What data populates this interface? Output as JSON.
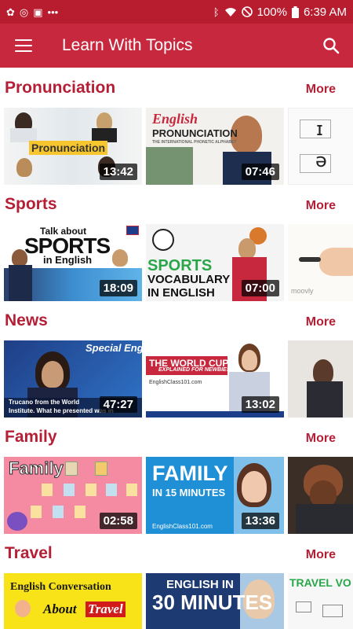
{
  "status": {
    "battery": "100%",
    "time": "6:39 AM"
  },
  "appbar": {
    "title": "Learn With Topics"
  },
  "sections": [
    {
      "title": "Pronunciation",
      "more": "More",
      "videos": [
        {
          "duration": "13:42",
          "caption": "Pronunciation"
        },
        {
          "duration": "07:46",
          "caption_1": "English",
          "caption_2": "PRONUNCIATION",
          "caption_3": "THE INTERNATIONAL PHONETIC ALPHABET"
        },
        {
          "caption_1": "ɪ",
          "caption_2": "ə"
        }
      ]
    },
    {
      "title": "Sports",
      "more": "More",
      "videos": [
        {
          "duration": "18:09",
          "caption_1": "Talk about",
          "caption_2": "SPORTS",
          "caption_3": "in English"
        },
        {
          "duration": "07:00",
          "caption_1": "SPORTS",
          "caption_2": "VOCABULARY",
          "caption_3": "IN ENGLISH"
        },
        {
          "caption_1": "moovly"
        }
      ]
    },
    {
      "title": "News",
      "more": "More",
      "videos": [
        {
          "duration": "47:27",
          "caption_1": "Special English",
          "caption_2": "Trucano from the World",
          "caption_3": "Institute. What he presented was in"
        },
        {
          "duration": "13:02",
          "caption_1": "THE WORLD CUP",
          "caption_2": "EXPLAINED FOR NEWBIES!",
          "caption_3": "EnglishClass101.com"
        },
        {}
      ]
    },
    {
      "title": "Family",
      "more": "More",
      "videos": [
        {
          "duration": "02:58",
          "caption_1": "Family"
        },
        {
          "duration": "13:36",
          "caption_1": "FAMILY",
          "caption_2": "IN 15 MINUTES",
          "caption_3": "EnglishClass101.com"
        },
        {}
      ]
    },
    {
      "title": "Travel",
      "more": "More",
      "videos": [
        {
          "caption_1": "English Conversation",
          "caption_2": "About",
          "caption_3": "Travel"
        },
        {
          "caption_1": "ENGLISH IN",
          "caption_2": "30 MINUTES"
        },
        {
          "caption_1": "TRAVEL VO"
        }
      ]
    }
  ],
  "colors": {
    "status_bar": "#b71c2f",
    "app_bar": "#c8283d",
    "section_title": "#b51f36"
  },
  "icons": [
    "menu-icon",
    "search-icon",
    "wifi-icon",
    "battery-icon",
    "bluetooth-icon"
  ]
}
